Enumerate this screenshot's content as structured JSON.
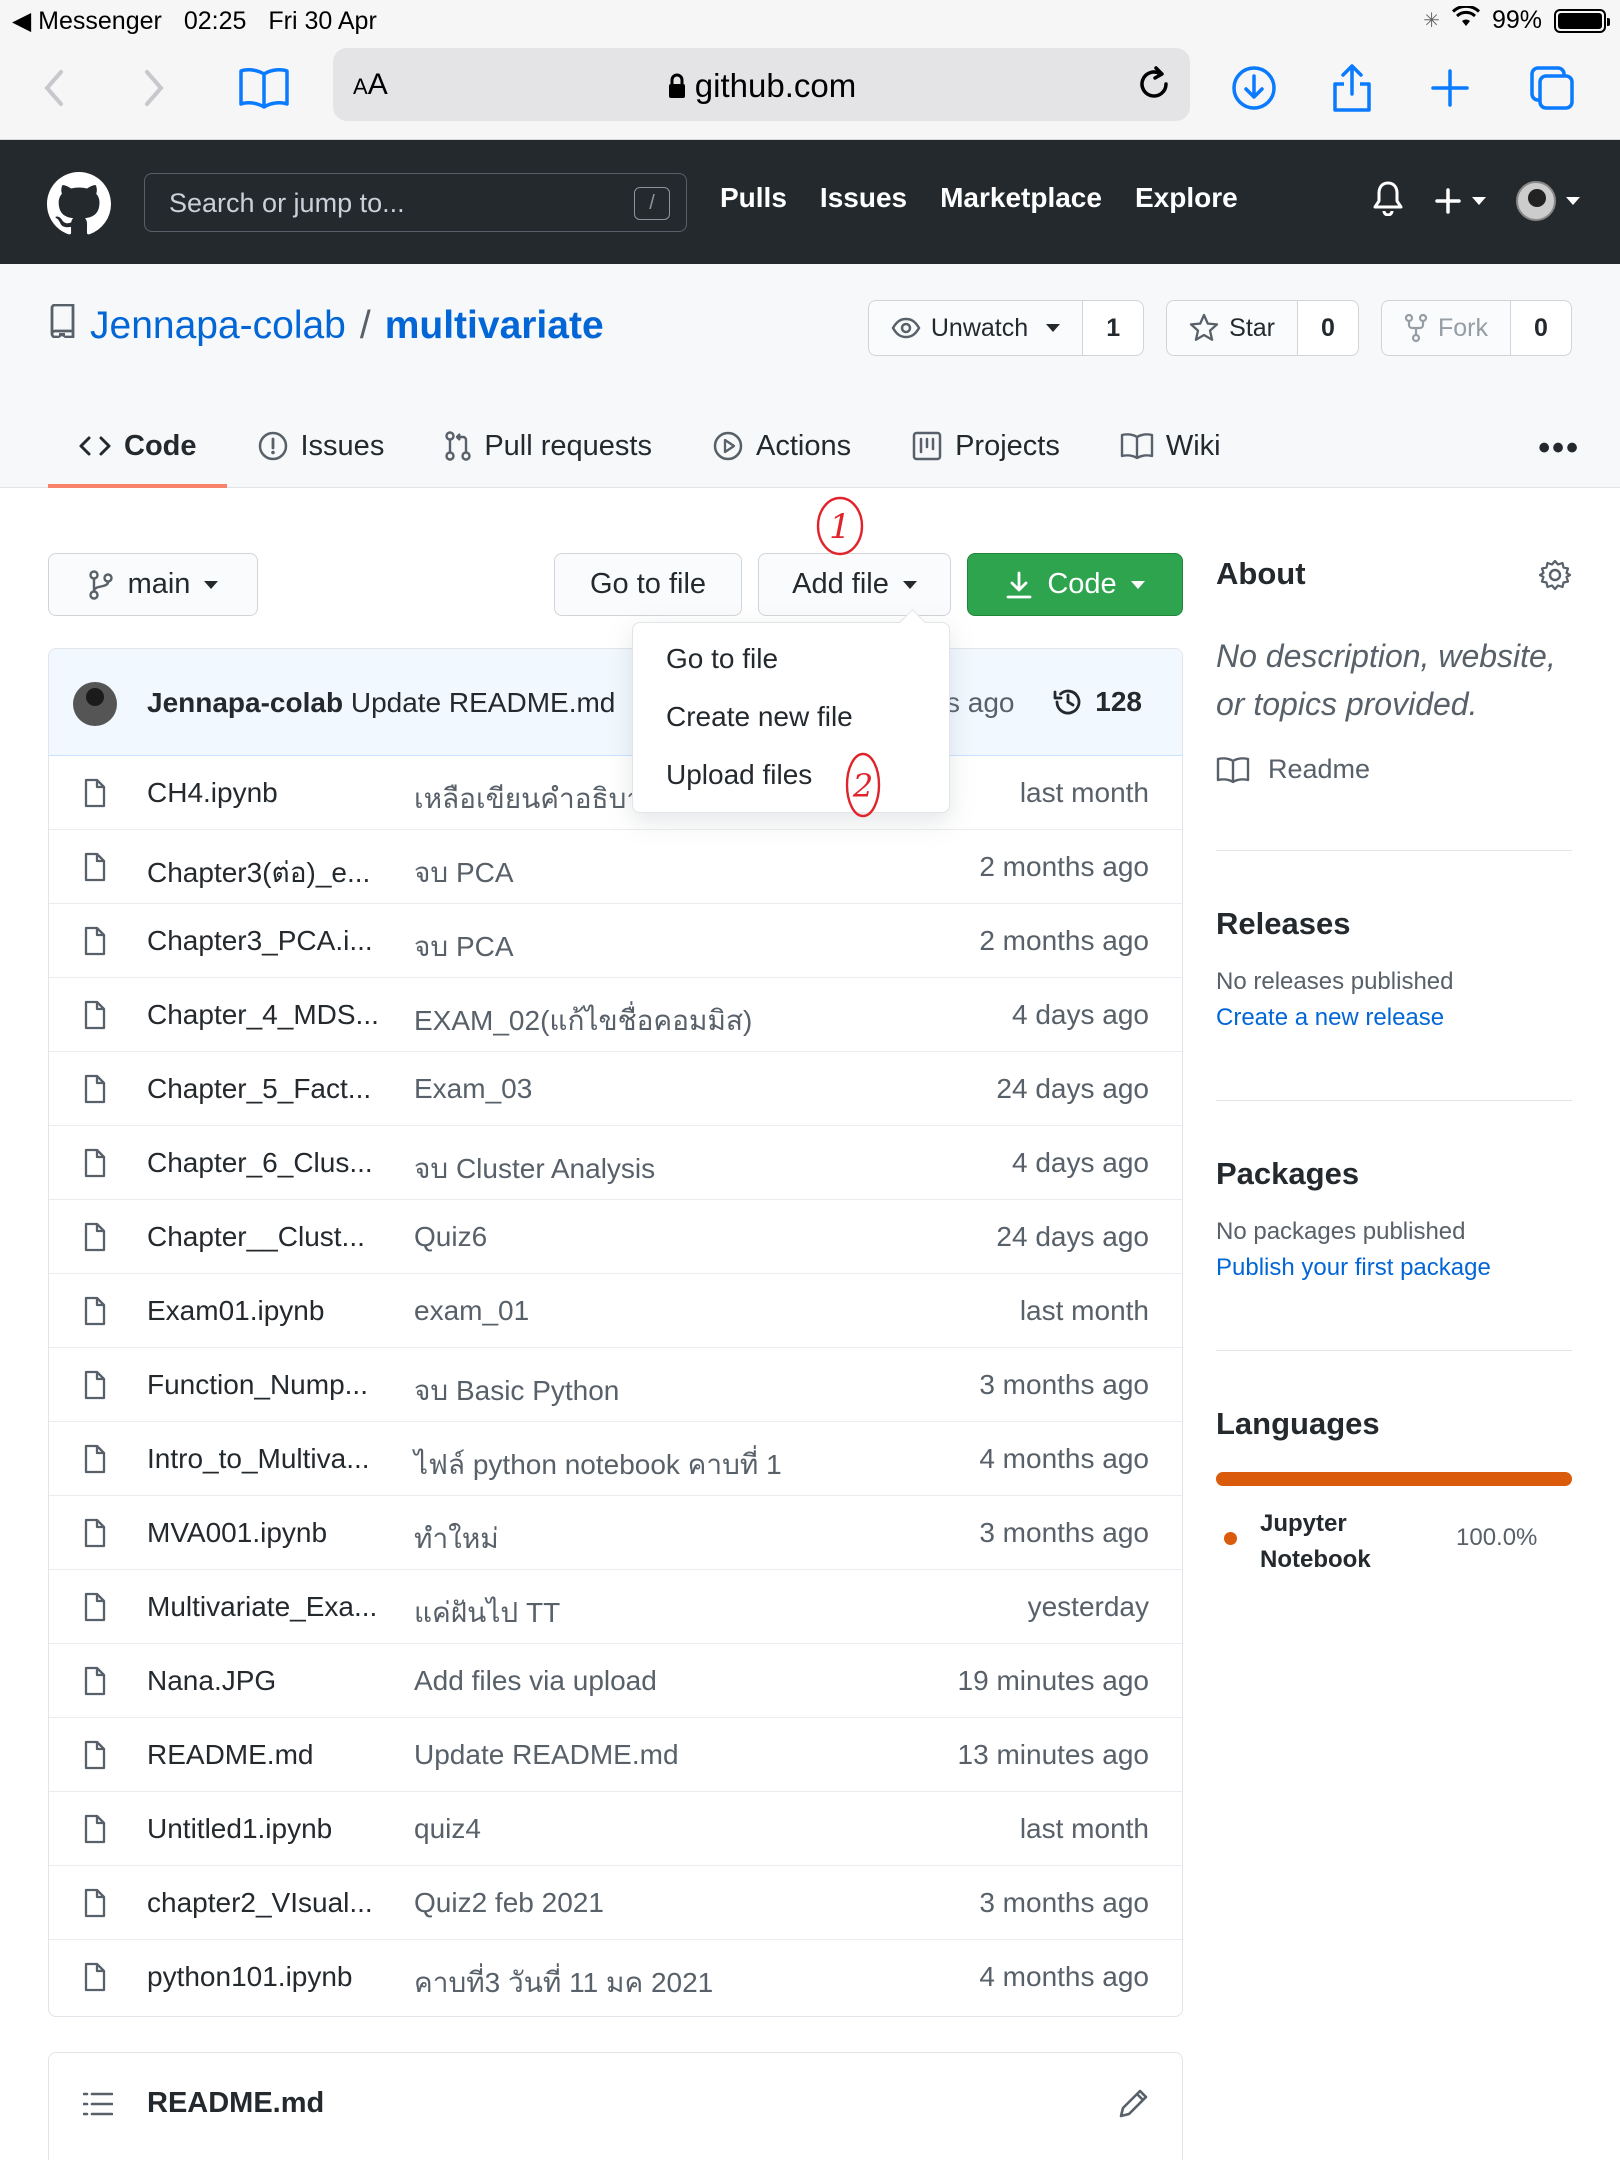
{
  "status_bar": {
    "back_app": "Messenger",
    "time": "02:25",
    "date": "Fri 30 Apr",
    "battery": "99%"
  },
  "safari": {
    "aa_label": "AA",
    "url": "github.com"
  },
  "gh_header": {
    "search_placeholder": "Search or jump to...",
    "slash_key": "/",
    "nav": [
      "Pulls",
      "Issues",
      "Marketplace",
      "Explore"
    ]
  },
  "repo": {
    "owner": "Jennapa-colab",
    "separator": "/",
    "name": "multivariate",
    "watch": {
      "label": "Unwatch",
      "count": "1"
    },
    "star": {
      "label": "Star",
      "count": "0"
    },
    "fork": {
      "label": "Fork",
      "count": "0"
    }
  },
  "tabs": [
    "Code",
    "Issues",
    "Pull requests",
    "Actions",
    "Projects",
    "Wiki"
  ],
  "toolbar": {
    "branch": "main",
    "go_to_file": "Go to file",
    "add_file": "Add file",
    "code": "Code"
  },
  "dropdown": [
    "Go to file",
    "Create new file",
    "Upload files"
  ],
  "annotations": [
    "1",
    "2"
  ],
  "commit": {
    "author": "Jennapa-colab",
    "message": "Update README.md",
    "time_fragment": "s ago",
    "commit_count": "128"
  },
  "files": [
    {
      "name": "CH4.ipynb",
      "message": "เหลือเขียนคำอธิบา",
      "time": "last month"
    },
    {
      "name": "Chapter3(ต่อ)_e...",
      "message": "จบ PCA",
      "time": "2 months ago"
    },
    {
      "name": "Chapter3_PCA.i...",
      "message": "จบ PCA",
      "time": "2 months ago"
    },
    {
      "name": "Chapter_4_MDS...",
      "message": "EXAM_02(แก้ไขชื่อคอมมิส)",
      "time": "4 days ago"
    },
    {
      "name": "Chapter_5_Fact...",
      "message": "Exam_03",
      "time": "24 days ago"
    },
    {
      "name": "Chapter_6_Clus...",
      "message": "จบ Cluster Analysis",
      "time": "4 days ago"
    },
    {
      "name": "Chapter__Clust...",
      "message": "Quiz6",
      "time": "24 days ago"
    },
    {
      "name": "Exam01.ipynb",
      "message": "exam_01",
      "time": "last month"
    },
    {
      "name": "Function_Nump...",
      "message": "จบ Basic Python",
      "time": "3 months ago"
    },
    {
      "name": "Intro_to_Multiva...",
      "message": "ไฟล์ python notebook คาบที่ 1",
      "time": "4 months ago"
    },
    {
      "name": "MVA001.ipynb",
      "message": "ทำใหม่",
      "time": "3 months ago"
    },
    {
      "name": "Multivariate_Exa...",
      "message": "แค่ฝันไป TT",
      "time": "yesterday"
    },
    {
      "name": "Nana.JPG",
      "message": "Add files via upload",
      "time": "19 minutes ago"
    },
    {
      "name": "README.md",
      "message": "Update README.md",
      "time": "13 minutes ago"
    },
    {
      "name": "Untitled1.ipynb",
      "message": "quiz4",
      "time": "last month"
    },
    {
      "name": "chapter2_VIsual...",
      "message": "Quiz2 feb 2021",
      "time": "3 months ago"
    },
    {
      "name": "python101.ipynb",
      "message": "คาบที่3 วันที่ 11 มค 2021",
      "time": "4 months ago"
    }
  ],
  "readme": {
    "title": "README.md"
  },
  "sidebar": {
    "about_title": "About",
    "about_desc": "No description, website, or topics provided.",
    "readme_link": "Readme",
    "releases_title": "Releases",
    "releases_empty": "No releases published",
    "releases_link": "Create a new release",
    "packages_title": "Packages",
    "packages_empty": "No packages published",
    "packages_link": "Publish your first package",
    "languages_title": "Languages",
    "language": {
      "name_line1": "Jupyter",
      "name_line2": "Notebook",
      "percent": "100.0%",
      "color": "#DA5B0B"
    }
  },
  "colors": {
    "gh_header_bg": "#24292e",
    "link": "#0366d6",
    "green_btn": "#2ea44f",
    "tab_underline": "#f9826c",
    "annotation": "#e0242b"
  }
}
